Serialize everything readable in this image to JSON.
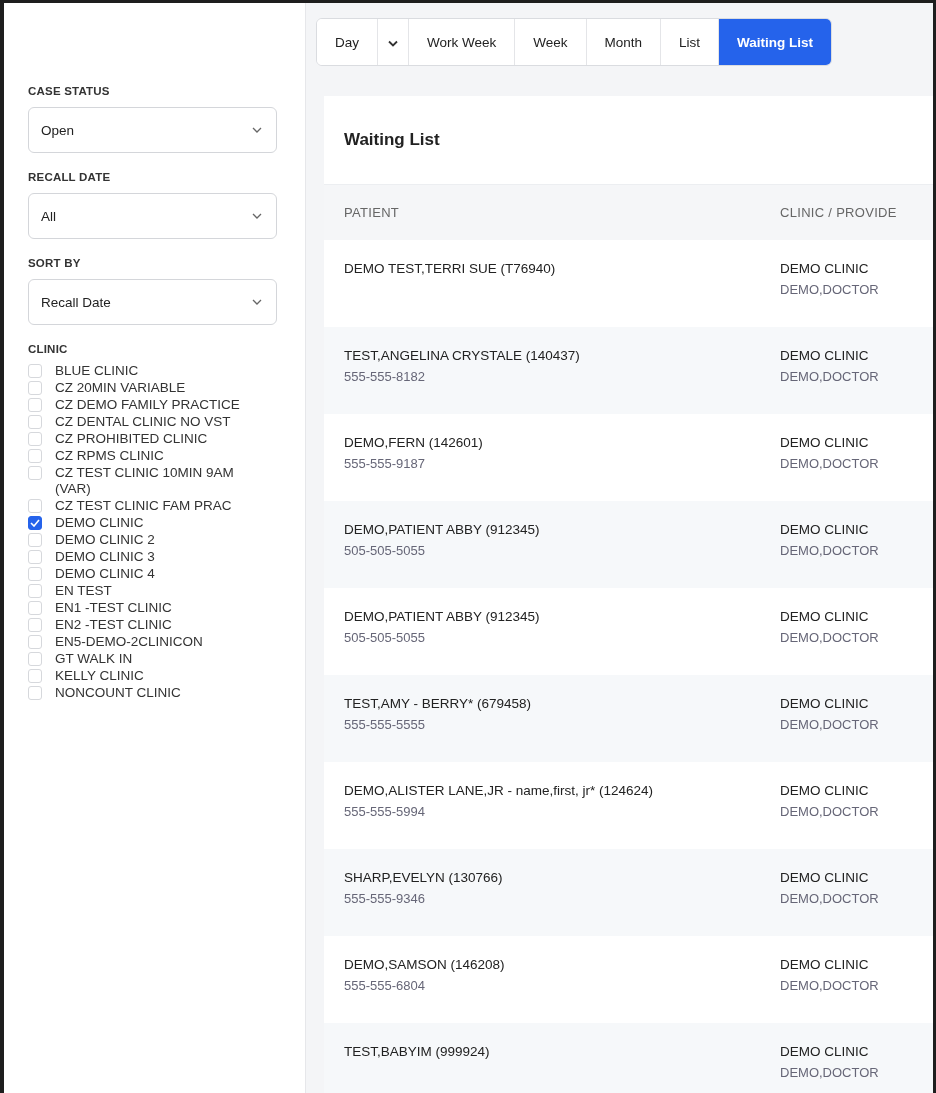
{
  "filters": [
    {
      "label": "CASE STATUS",
      "value": "Open"
    },
    {
      "label": "RECALL DATE",
      "value": "All"
    },
    {
      "label": "SORT BY",
      "value": "Recall Date"
    }
  ],
  "clinic": {
    "label": "CLINIC",
    "options": [
      {
        "label": "BLUE CLINIC",
        "checked": false
      },
      {
        "label": "CZ 20MIN VARIABLE",
        "checked": false
      },
      {
        "label": "CZ DEMO FAMILY PRACTICE",
        "checked": false
      },
      {
        "label": "CZ DENTAL CLINIC NO VST",
        "checked": false
      },
      {
        "label": "CZ PROHIBITED CLINIC",
        "checked": false
      },
      {
        "label": "CZ RPMS CLINIC",
        "checked": false
      },
      {
        "label": "CZ TEST CLINIC 10MIN 9AM (VAR)",
        "checked": false
      },
      {
        "label": "CZ TEST CLINIC FAM PRAC",
        "checked": false
      },
      {
        "label": "DEMO CLINIC",
        "checked": true
      },
      {
        "label": "DEMO CLINIC 2",
        "checked": false
      },
      {
        "label": "DEMO CLINIC 3",
        "checked": false
      },
      {
        "label": "DEMO CLINIC 4",
        "checked": false
      },
      {
        "label": "EN TEST",
        "checked": false
      },
      {
        "label": "EN1 -TEST CLINIC",
        "checked": false
      },
      {
        "label": "EN2 -TEST CLINIC",
        "checked": false
      },
      {
        "label": "EN5-DEMO-2CLINICON",
        "checked": false
      },
      {
        "label": "GT WALK IN",
        "checked": false
      },
      {
        "label": "KELLY CLINIC",
        "checked": false
      },
      {
        "label": "NONCOUNT CLINIC",
        "checked": false
      }
    ]
  },
  "tabs": [
    {
      "kind": "label",
      "label": "Day",
      "selected": false
    },
    {
      "kind": "menu",
      "selected": false
    },
    {
      "kind": "label",
      "label": "Work Week",
      "selected": false
    },
    {
      "kind": "label",
      "label": "Week",
      "selected": false
    },
    {
      "kind": "label",
      "label": "Month",
      "selected": false
    },
    {
      "kind": "label",
      "label": "List",
      "selected": false
    },
    {
      "kind": "label",
      "label": "Waiting List",
      "selected": true
    }
  ],
  "table": {
    "title": "Waiting List",
    "columns": [
      "PATIENT",
      "CLINIC / PROVIDE"
    ],
    "rows": [
      {
        "patient": "DEMO TEST,TERRI SUE (T76940)",
        "clinic": "DEMO CLINIC",
        "provider": "DEMO,DOCTOR"
      },
      {
        "patient": "TEST,ANGELINA CRYSTALE (140437)",
        "phone": "555-555-8182",
        "clinic": "DEMO CLINIC",
        "provider": "DEMO,DOCTOR"
      },
      {
        "patient": "DEMO,FERN (142601)",
        "phone": "555-555-9187",
        "clinic": "DEMO CLINIC",
        "provider": "DEMO,DOCTOR"
      },
      {
        "patient": "DEMO,PATIENT ABBY (912345)",
        "phone": "505-505-5055",
        "clinic": "DEMO CLINIC",
        "provider": "DEMO,DOCTOR"
      },
      {
        "patient": "DEMO,PATIENT ABBY (912345)",
        "phone": "505-505-5055",
        "clinic": "DEMO CLINIC",
        "provider": "DEMO,DOCTOR"
      },
      {
        "patient": "TEST,AMY - BERRY* (679458)",
        "phone": "555-555-5555",
        "clinic": "DEMO CLINIC",
        "provider": "DEMO,DOCTOR"
      },
      {
        "patient": "DEMO,ALISTER LANE,JR - name,first, jr* (124624)",
        "phone": "555-555-5994",
        "clinic": "DEMO CLINIC",
        "provider": "DEMO,DOCTOR"
      },
      {
        "patient": "SHARP,EVELYN (130766)",
        "phone": "555-555-9346",
        "clinic": "DEMO CLINIC",
        "provider": "DEMO,DOCTOR"
      },
      {
        "patient": "DEMO,SAMSON (146208)",
        "phone": "555-555-6804",
        "clinic": "DEMO CLINIC",
        "provider": "DEMO,DOCTOR"
      },
      {
        "patient": "TEST,BABYIM (999924)",
        "clinic": "DEMO CLINIC",
        "provider": "DEMO,DOCTOR"
      }
    ]
  }
}
